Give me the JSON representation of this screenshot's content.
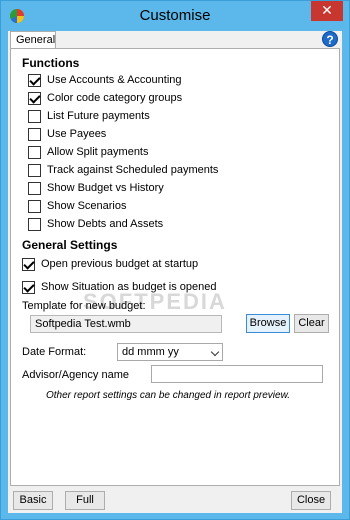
{
  "window": {
    "title": "Customise",
    "close_glyph": "✕"
  },
  "tabs": [
    {
      "label": "General"
    }
  ],
  "help_glyph": "?",
  "functions": {
    "heading": "Functions",
    "items": [
      {
        "label": "Use Accounts & Accounting",
        "checked": true
      },
      {
        "label": "Color code category groups",
        "checked": true
      },
      {
        "label": "List Future payments",
        "checked": false
      },
      {
        "label": "Use Payees",
        "checked": false
      },
      {
        "label": "Allow Split payments",
        "checked": false
      },
      {
        "label": "Track against Scheduled payments",
        "checked": false
      },
      {
        "label": "Show Budget vs History",
        "checked": false
      },
      {
        "label": "Show Scenarios",
        "checked": false
      },
      {
        "label": "Show Debts and Assets",
        "checked": false
      }
    ]
  },
  "general": {
    "heading": "General Settings",
    "items": [
      {
        "label": "Open previous budget at startup",
        "checked": true
      },
      {
        "label": "Show Situation as budget is opened",
        "checked": true
      }
    ],
    "template_label": "Template for new budget:",
    "template_value": "Softpedia Test.wmb",
    "browse_label": "Browse",
    "clear_label": "Clear",
    "date_format_label": "Date Format:",
    "date_format_value": "dd mmm yy",
    "advisor_label": "Advisor/Agency name",
    "advisor_value": "",
    "note": "Other report settings can be changed in report preview."
  },
  "footer": {
    "basic_label": "Basic",
    "full_label": "Full",
    "close_label": "Close"
  },
  "watermark": "SOFTPEDIA",
  "colors": {
    "titlebar": "#5cb8ea",
    "close": "#c7372f",
    "help": "#1e6ac8"
  }
}
